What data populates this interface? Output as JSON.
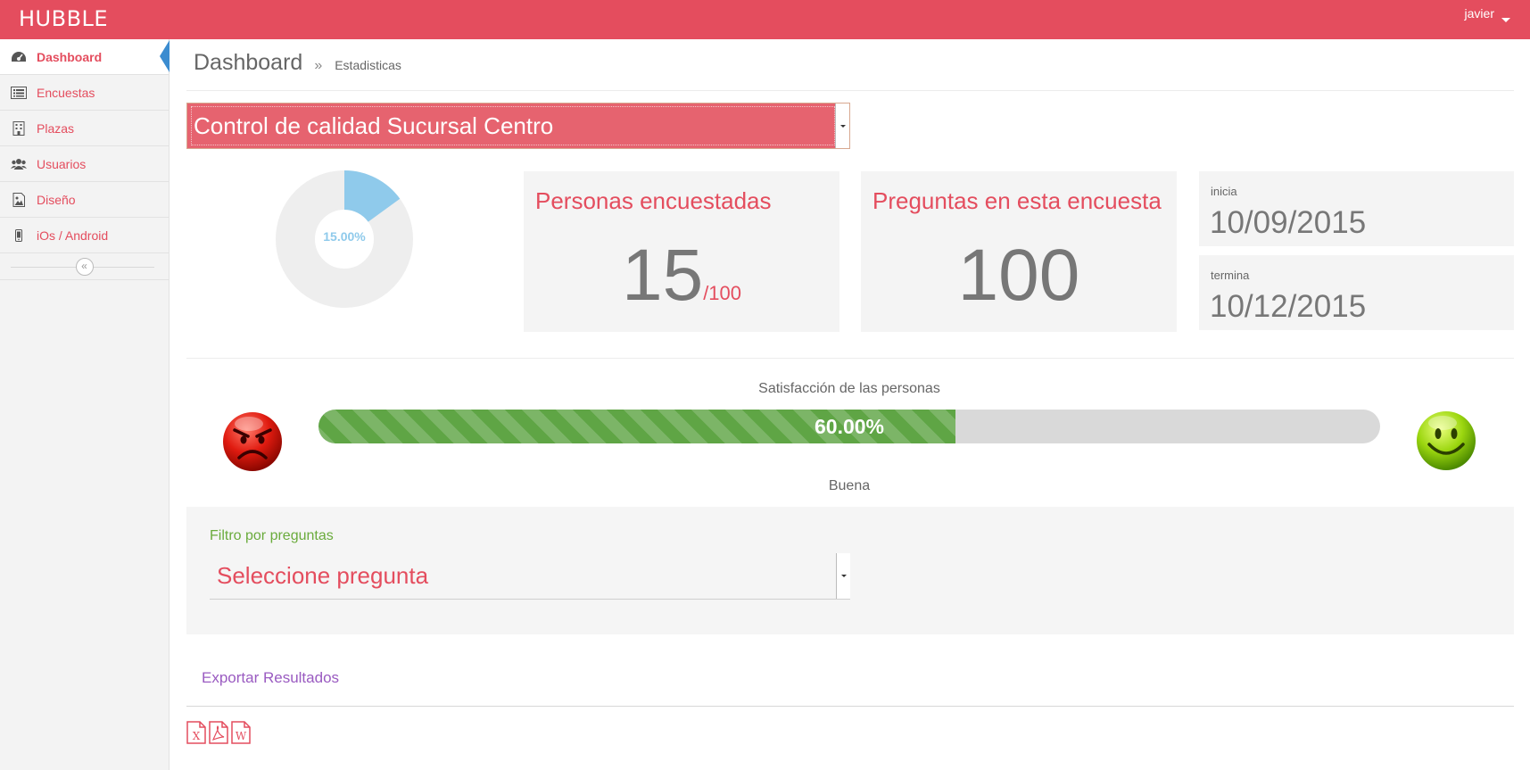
{
  "topbar": {
    "brand": "HUBBLE",
    "user": "javier"
  },
  "sidebar": {
    "items": [
      {
        "label": "Dashboard",
        "icon": "dashboard-icon",
        "active": true
      },
      {
        "label": "Encuestas",
        "icon": "list-icon"
      },
      {
        "label": "Plazas",
        "icon": "building-icon"
      },
      {
        "label": "Usuarios",
        "icon": "users-icon"
      },
      {
        "label": "Diseño",
        "icon": "image-icon"
      },
      {
        "label": "iOs / Android",
        "icon": "mobile-icon"
      }
    ],
    "collapse_icon": "«"
  },
  "breadcrumb": {
    "title": "Dashboard",
    "separator": "»",
    "current": "Estadisticas"
  },
  "survey_select": {
    "selected": "Control de calidad Sucursal Centro"
  },
  "completion": {
    "percent": 15.0,
    "label": "15.00%",
    "color": "#8fcaeb",
    "track_color": "#eeeeee"
  },
  "stats": {
    "surveyed": {
      "title": "Personas encuestadas",
      "value": "15",
      "total": "/100"
    },
    "questions": {
      "title": "Preguntas en esta encuesta",
      "value": "100"
    }
  },
  "dates": {
    "start": {
      "label": "inicia",
      "value": "10/09/2015"
    },
    "end": {
      "label": "termina",
      "value": "10/12/2015"
    }
  },
  "satisfaction": {
    "title": "Satisfacción de las personas",
    "percent": 60.0,
    "label": "60.00%",
    "level": "Buena",
    "bar_color": "#5fa545"
  },
  "filter": {
    "label": "Filtro por preguntas",
    "placeholder": "Seleccione pregunta"
  },
  "export": {
    "link": "Exportar Resultados",
    "formats": [
      {
        "name": "excel-icon",
        "letter": "X"
      },
      {
        "name": "pdf-icon",
        "letter": ""
      },
      {
        "name": "word-icon",
        "letter": "W"
      }
    ]
  },
  "colors": {
    "accent": "#e44d5e",
    "sidebar_active": "#3b8cd0"
  }
}
